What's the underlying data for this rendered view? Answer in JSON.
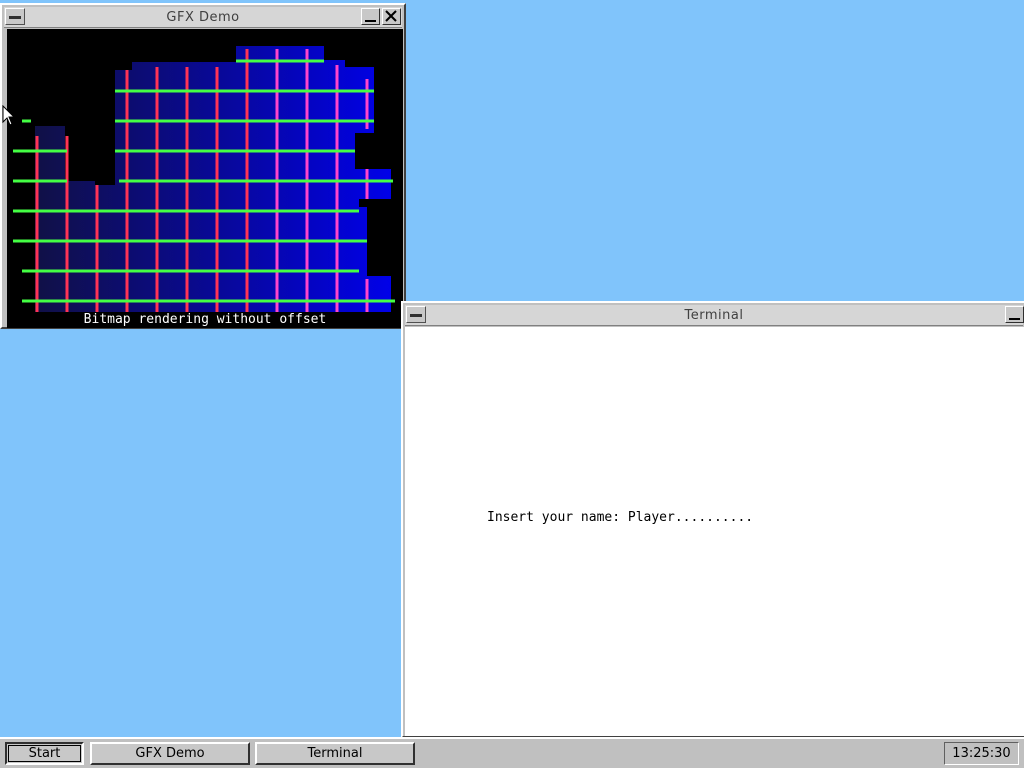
{
  "desktop": {
    "background": "#80c4fb"
  },
  "gfx_window": {
    "title": "GFX Demo",
    "caption": "Bitmap rendering without offset",
    "icons": [
      "system-menu-icon",
      "minimize-icon",
      "close-icon"
    ]
  },
  "terminal_window": {
    "title": "Terminal",
    "prompt_line": "Insert your name: Player..........",
    "icons": [
      "system-menu-icon",
      "minimize-icon"
    ]
  },
  "taskbar": {
    "start_label": "Start",
    "tasks": [
      {
        "label": "GFX Demo"
      },
      {
        "label": "Terminal"
      }
    ],
    "clock": "13:25:30"
  },
  "colors": {
    "vertical_lines": "#ff3355",
    "horizontal_lines": "#44ff44",
    "gradient_dark": "#101040",
    "gradient_bright": "#0000ff"
  }
}
